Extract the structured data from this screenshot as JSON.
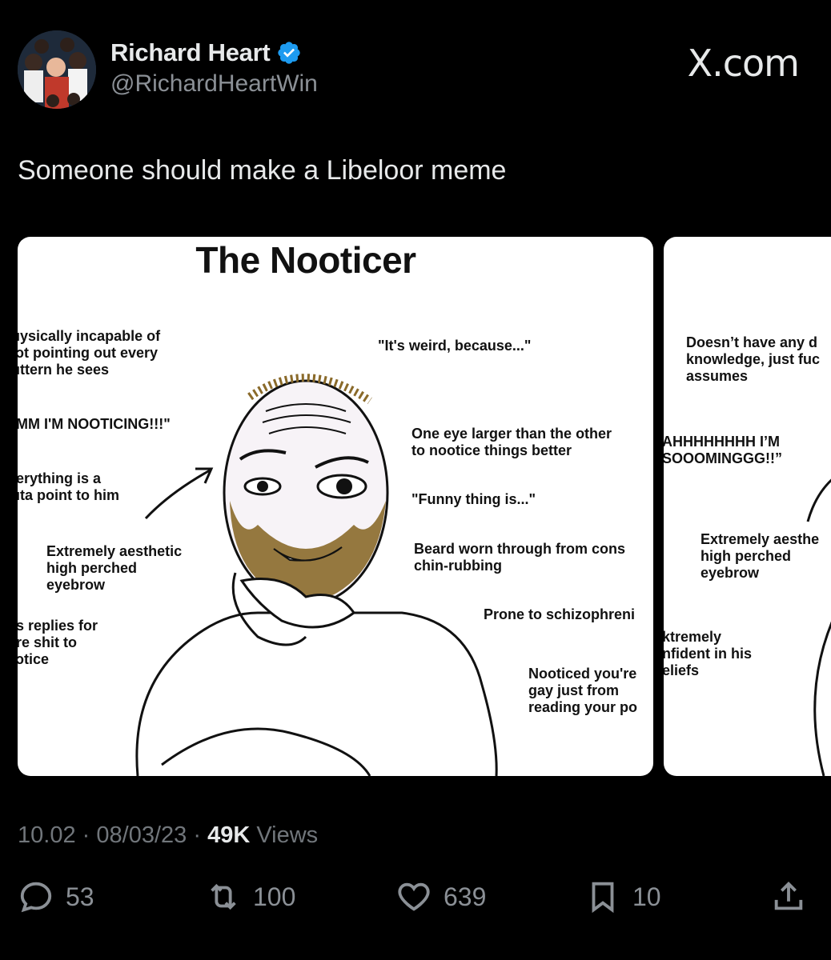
{
  "author": {
    "display_name": "Richard Heart",
    "handle": "@RichardHeartWin",
    "verified_icon": "verified-badge-icon",
    "accent": "#1d9bf0"
  },
  "brand": "X.com",
  "tweet": {
    "text": "Someone should make a Libeloor meme"
  },
  "meme": {
    "title": "The Nooticer",
    "labels_left": [
      "ıysically incapable of\nɔt pointing out every\nıttern he sees",
      "MM I'M NOOTICING!!!\"",
      "erything is a\nıta point to him",
      "Extremely aesthetic\nhigh perched\neyebrow",
      "s replies for\nre shit to\nɔtice"
    ],
    "labels_right": [
      "\"It's weird, because...\"",
      "One eye larger than the other\nto nootice things better",
      "\"Funny thing is...\"",
      "Beard worn through from cons\nchin-rubbing",
      "Prone to schizophreni",
      "Nooticed you're\ngay just from\nreading your po"
    ],
    "labels_card2": [
      "Doesn’t have any d\nknowledge, just fuc\nassumes",
      "AHHHHHHHH I’M\nSOOOMINGGG!!”",
      "Extremely aesthe\nhigh perched\neyebrow",
      "ktremely\nnfident in his\neliefs"
    ],
    "beard_color": "#8a6a2a"
  },
  "meta": {
    "time": "10.02",
    "date": "08/03/23",
    "views_count": "49K",
    "views_label": "Views",
    "separator": "·"
  },
  "actions": {
    "replies": "53",
    "reposts": "100",
    "likes": "639",
    "bookmarks": "10"
  }
}
